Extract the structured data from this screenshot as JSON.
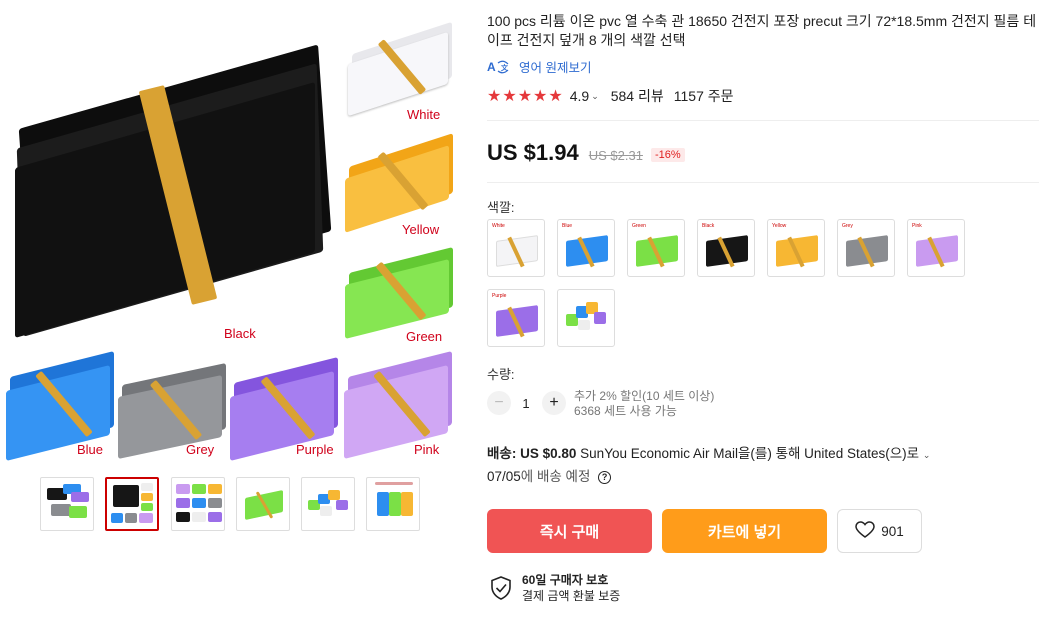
{
  "gallery": {
    "labels": {
      "white": "White",
      "yellow": "Yellow",
      "black": "Black",
      "green": "Green",
      "blue": "Blue",
      "grey": "Grey",
      "purple": "Purple",
      "pink": "Pink"
    },
    "colors": {
      "white": "#f4f4f6",
      "yellow": "#f7b733",
      "black": "#161616",
      "green": "#7be046",
      "blue": "#2d8ef0",
      "grey": "#8a8c90",
      "purple": "#9b6ee8",
      "pink": "#c99bf0",
      "band": "#d9a233"
    },
    "thumbnails_selected_index": 1
  },
  "product": {
    "title": "100 pcs 리튬 이온 pvc 열 수축 관 18650 건전지 포장 precut 크기 72*18.5mm 건전지 필름 테이프 건전지 덮개 8 개의 색깔 선택",
    "translate_label": "영어 원제보기",
    "translate_icon": "translate-icon",
    "rating": "4.9",
    "reviews": "584 리뷰",
    "orders": "1157 주문",
    "price": "US $1.94",
    "old_price": "US $2.31",
    "discount": "-16%",
    "color_label": "색깔:",
    "swatches": [
      {
        "name": "White",
        "color": "#f4f4f6"
      },
      {
        "name": "Blue",
        "color": "#2d8ef0"
      },
      {
        "name": "Green",
        "color": "#7be046"
      },
      {
        "name": "Black",
        "color": "#161616"
      },
      {
        "name": "Yellow",
        "color": "#f7b733"
      },
      {
        "name": "Grey",
        "color": "#8a8c90"
      },
      {
        "name": "Pink",
        "color": "#c99bf0"
      },
      {
        "name": "Purple",
        "color": "#9b6ee8"
      },
      {
        "name": "",
        "color": "mixed"
      }
    ],
    "qty_label": "수량:",
    "qty_value": "1",
    "qty_note_1": "추가 2% 할인(10 세트 이상)",
    "qty_note_2": "6368 세트 사용 가능",
    "shipping_label": "배송:",
    "shipping_price": "US $0.80",
    "shipping_text": "SunYou Economic Air Mail을(를) 통해 United States(으)로",
    "delivery_date": "07/05",
    "delivery_suffix": "에 배송 예정",
    "buy_now": "즉시 구매",
    "add_to_cart": "카트에 넣기",
    "wishlist_count": "901",
    "guarantee_title": "60일 구매자 보호",
    "guarantee_sub": "결제 금액 환불 보증"
  }
}
